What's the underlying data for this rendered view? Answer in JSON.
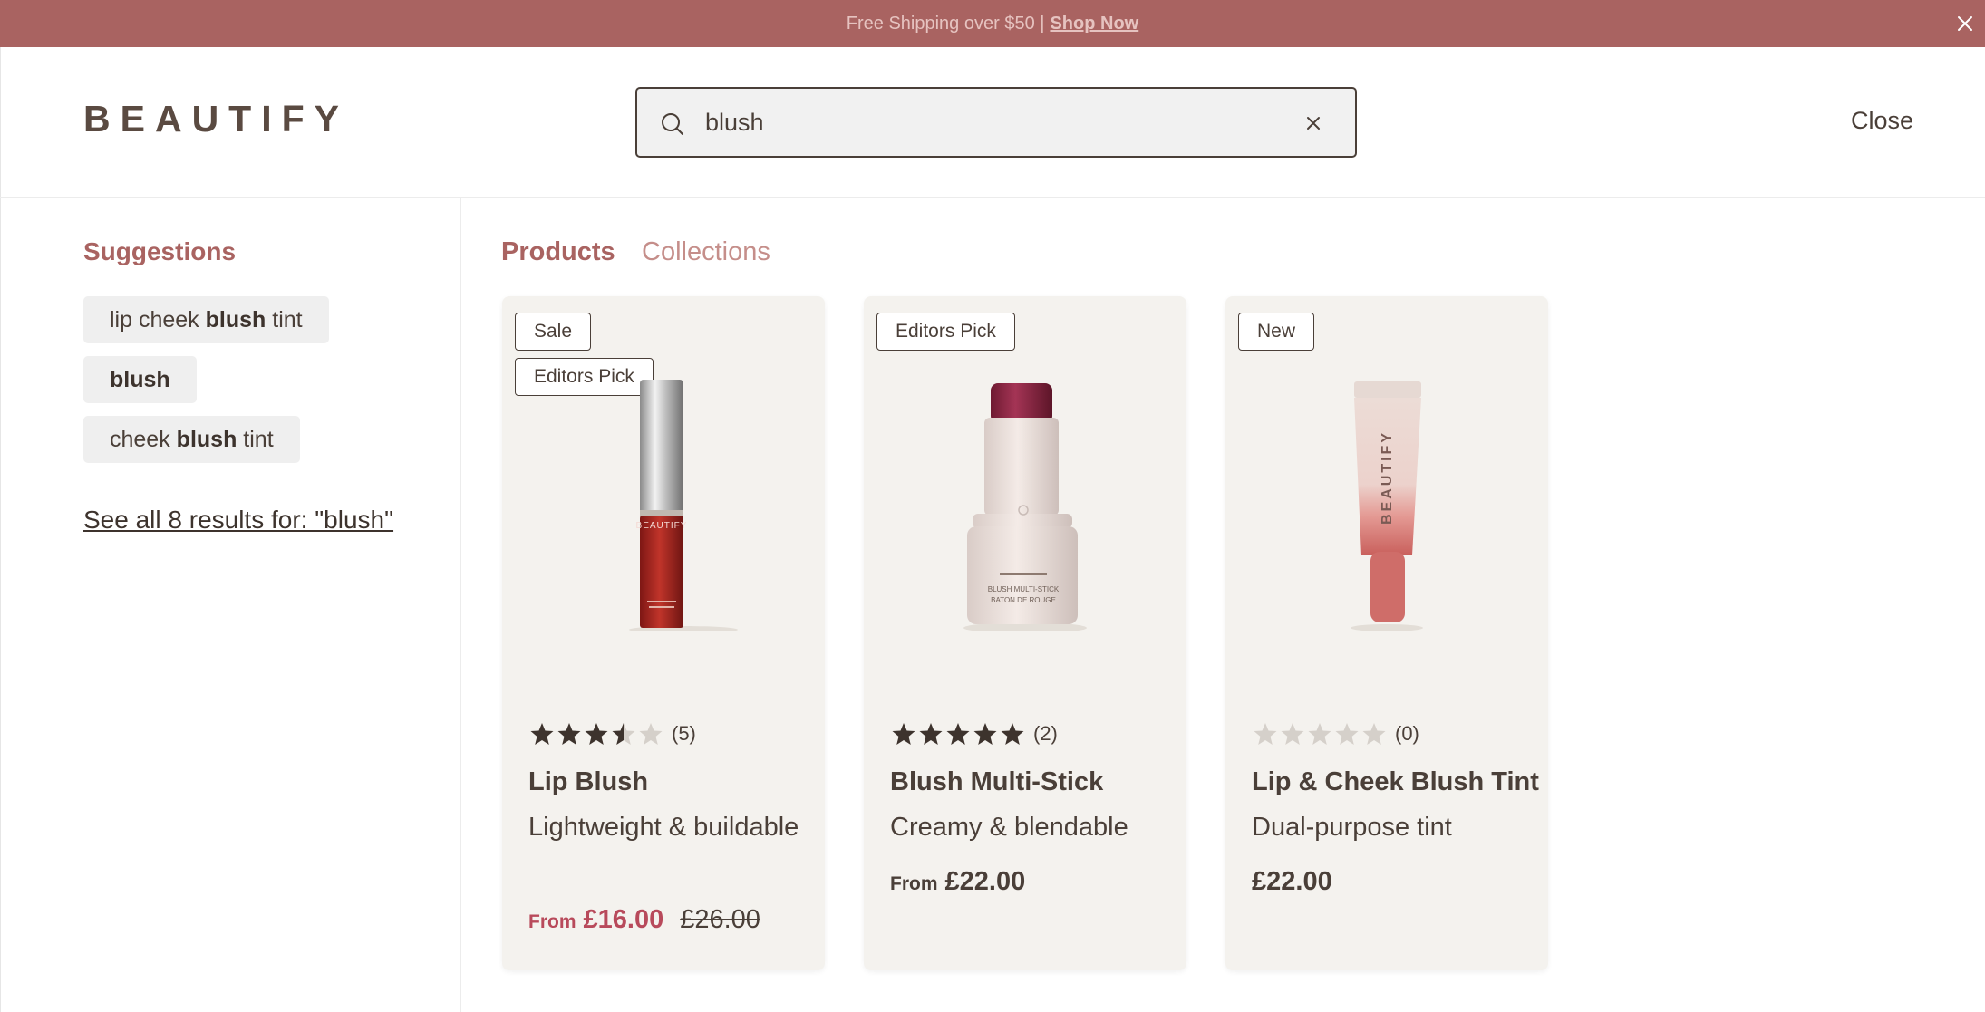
{
  "announcement": {
    "text": "Free Shipping over $50 |",
    "link": "Shop Now"
  },
  "header": {
    "logo": "BEAUTIFY",
    "search_value": "blush",
    "close_label": "Close"
  },
  "suggestions": {
    "title": "Suggestions",
    "items": [
      {
        "pre": "lip cheek ",
        "bold": "blush",
        "post": " tint"
      },
      {
        "pre": "",
        "bold": "blush",
        "post": ""
      },
      {
        "pre": "cheek ",
        "bold": "blush",
        "post": " tint"
      }
    ],
    "see_all": "See all 8 results for: \"blush\""
  },
  "tabs": {
    "products": "Products",
    "collections": "Collections"
  },
  "products": [
    {
      "badges": [
        "Sale",
        "Editors Pick"
      ],
      "rating": 3.5,
      "review_count": "(5)",
      "name": "Lip Blush",
      "description": "Lightweight & buildable",
      "from": "From",
      "price": "£16.00",
      "compare_price": "£26.00",
      "image_text": "BEAUTIFY"
    },
    {
      "badges": [
        "Editors Pick"
      ],
      "rating": 5,
      "review_count": "(2)",
      "name": "Blush Multi-Stick",
      "description": "Creamy & blendable",
      "from": "From",
      "price": "£22.00",
      "image_text_1": "BLUSH MULTI-STICK",
      "image_text_2": "BATON DE ROUGE"
    },
    {
      "badges": [
        "New"
      ],
      "rating": 0,
      "review_count": "(0)",
      "name": "Lip & Cheek Blush Tint",
      "description": "Dual-purpose tint",
      "price": "£22.00",
      "image_text": "BEAUTIFY"
    }
  ],
  "colors": {
    "announcement_bg": "#a96361",
    "accent": "#a96361",
    "sale_price": "#b84a5b",
    "card_bg": "#f4f2ee",
    "text": "#4a3f38"
  }
}
